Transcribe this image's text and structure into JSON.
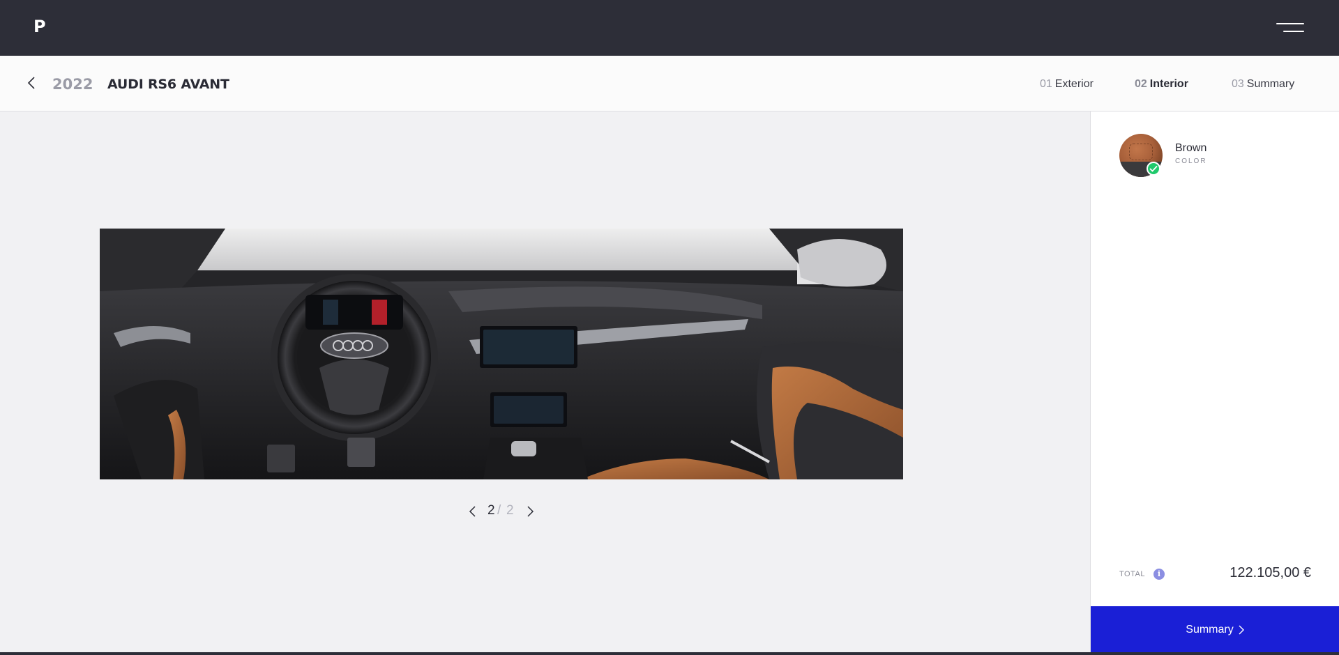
{
  "brand": {
    "logo_letter": "P"
  },
  "vehicle": {
    "year": "2022",
    "model": "AUDI RS6 AVANT"
  },
  "steps": [
    {
      "number": "01",
      "label": "Exterior",
      "active": false
    },
    {
      "number": "02",
      "label": "Interior",
      "active": true
    },
    {
      "number": "03",
      "label": "Summary",
      "active": false
    }
  ],
  "option": {
    "name": "Brown",
    "category": "COLOR",
    "selected": true
  },
  "pager": {
    "current": "2",
    "separator": "/",
    "total": "2"
  },
  "pricing": {
    "total_label": "TOTAL",
    "info_glyph": "i",
    "total_value": "122.105,00 €"
  },
  "cta": {
    "label": "Summary"
  },
  "colors": {
    "topbar": "#2d2e38",
    "cta": "#1a1fd6",
    "check": "#20c96c",
    "info": "#8b8ee2",
    "upholstery": "#a8603a"
  },
  "icons": [
    "menu-icon",
    "back-arrow-icon",
    "check-icon",
    "info-icon",
    "chevron-left-icon",
    "chevron-right-icon"
  ]
}
